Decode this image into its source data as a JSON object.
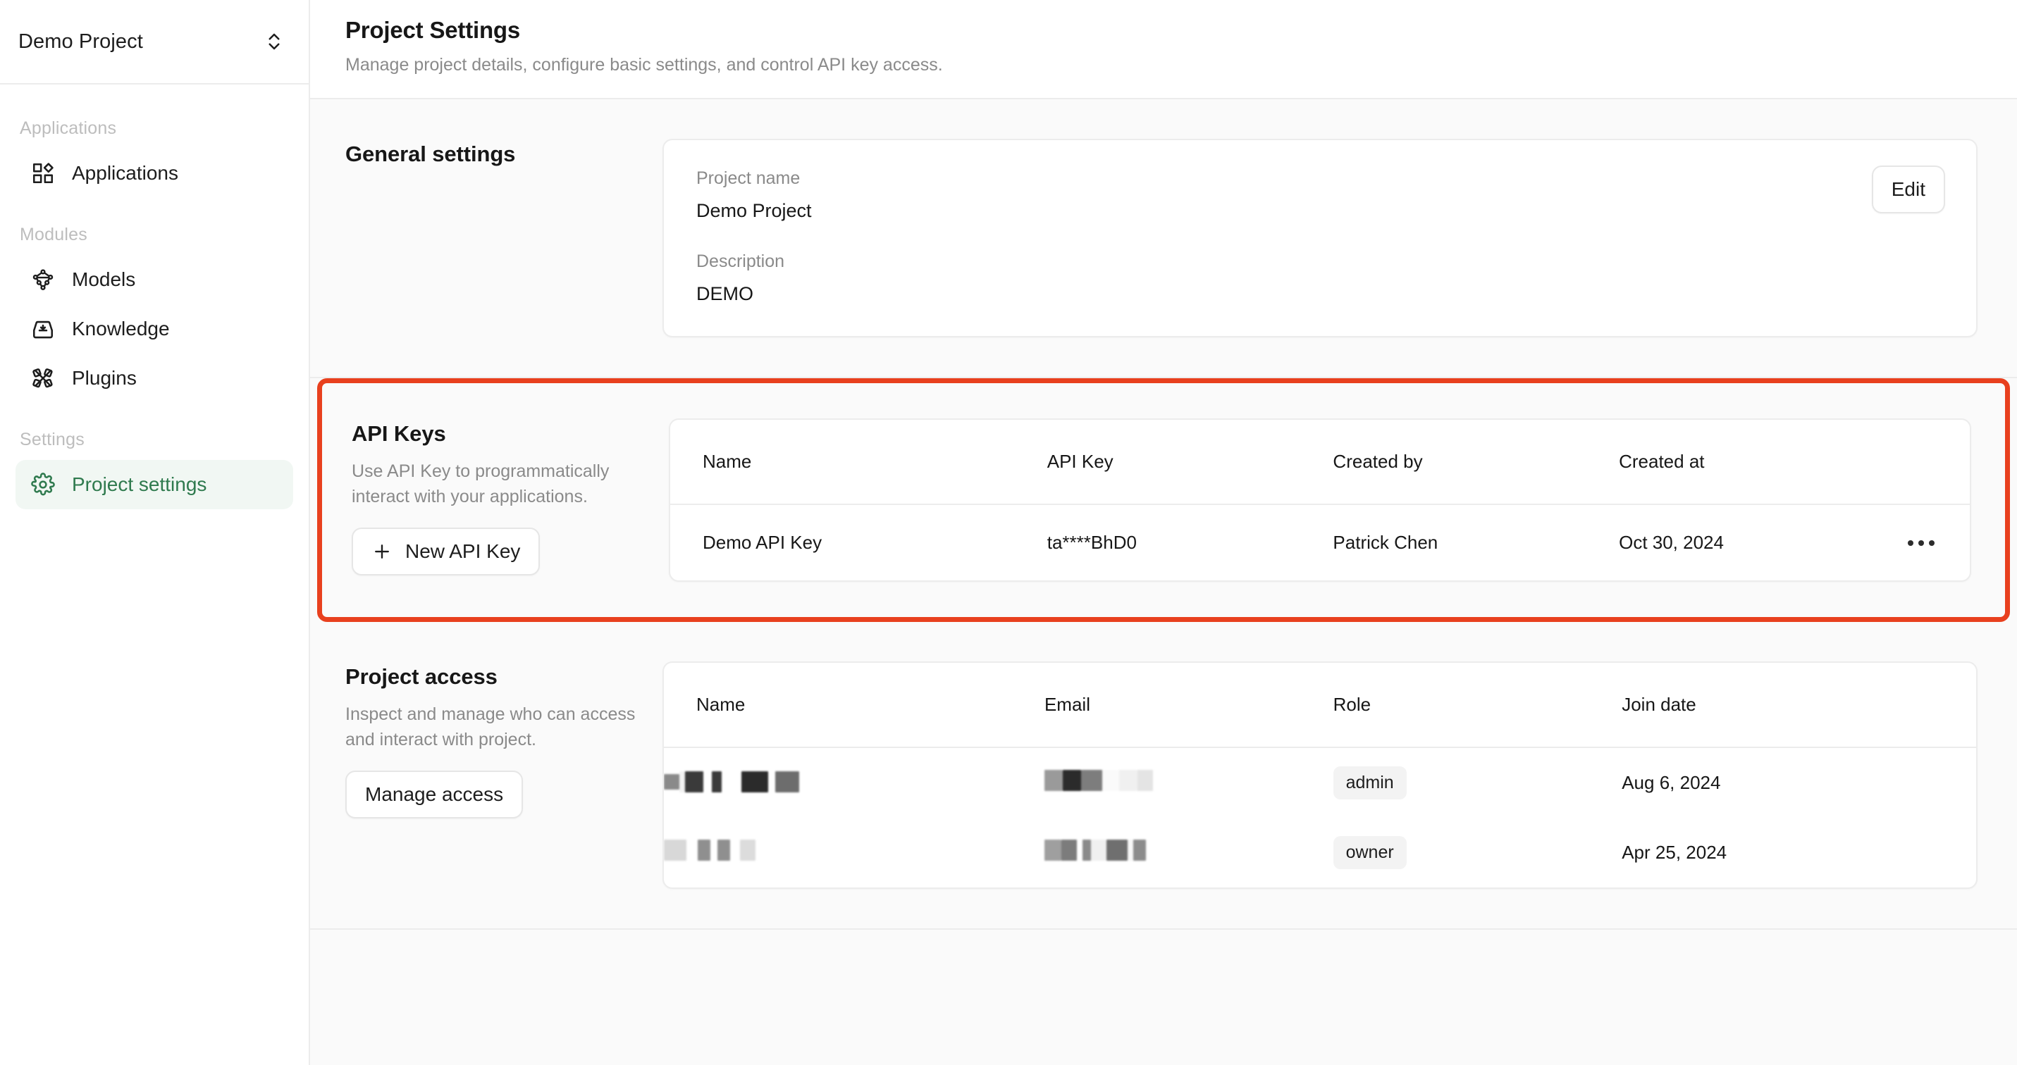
{
  "sidebar": {
    "project_switcher": {
      "name": "Demo Project",
      "icon": "chevron-up-down-icon"
    },
    "groups": [
      {
        "label": "Applications",
        "items": [
          {
            "label": "Applications",
            "icon": "grid-apps-icon",
            "active": false
          }
        ]
      },
      {
        "label": "Modules",
        "items": [
          {
            "label": "Models",
            "icon": "models-network-icon",
            "active": false
          },
          {
            "label": "Knowledge",
            "icon": "knowledge-inbox-icon",
            "active": false
          },
          {
            "label": "Plugins",
            "icon": "plugins-puzzle-icon",
            "active": false
          }
        ]
      },
      {
        "label": "Settings",
        "items": [
          {
            "label": "Project settings",
            "icon": "gear-icon",
            "active": true
          }
        ]
      }
    ]
  },
  "header": {
    "title": "Project Settings",
    "subtitle": "Manage project details, configure basic settings, and control API key access."
  },
  "general_settings": {
    "title": "General settings",
    "edit_label": "Edit",
    "fields": [
      {
        "label": "Project name",
        "value": "Demo Project"
      },
      {
        "label": "Description",
        "value": "DEMO"
      }
    ]
  },
  "api_keys": {
    "title": "API Keys",
    "description": "Use API Key to programmatically interact with your applications.",
    "new_key_label": "New API Key",
    "new_key_icon": "plus-icon",
    "highlighted": true,
    "highlight_color": "#e8401e",
    "columns": [
      "Name",
      "API Key",
      "Created by",
      "Created at"
    ],
    "rows": [
      {
        "name": "Demo API Key",
        "key": "ta****BhD0",
        "created_by": "Patrick Chen",
        "created_at": "Oct 30, 2024",
        "menu_icon": "ellipsis-icon"
      }
    ]
  },
  "project_access": {
    "title": "Project access",
    "description": "Inspect and manage who can access and interact with project.",
    "manage_label": "Manage access",
    "columns": [
      "Name",
      "Email",
      "Role",
      "Join date"
    ],
    "rows": [
      {
        "name": "[redacted]",
        "email": "[redacted]",
        "role": "admin",
        "join_date": "Aug 6, 2024"
      },
      {
        "name": "[redacted]",
        "email": "[redacted]",
        "role": "owner",
        "join_date": "Apr 25, 2024"
      }
    ]
  },
  "theme": {
    "accent_green": "#2f7a4e",
    "accent_green_bg": "#f1f7f3",
    "highlight_red": "#e8401e",
    "page_bg": "#fafafa",
    "card_bg": "#ffffff",
    "border": "#ececec",
    "muted_text": "#8a8a8a"
  }
}
